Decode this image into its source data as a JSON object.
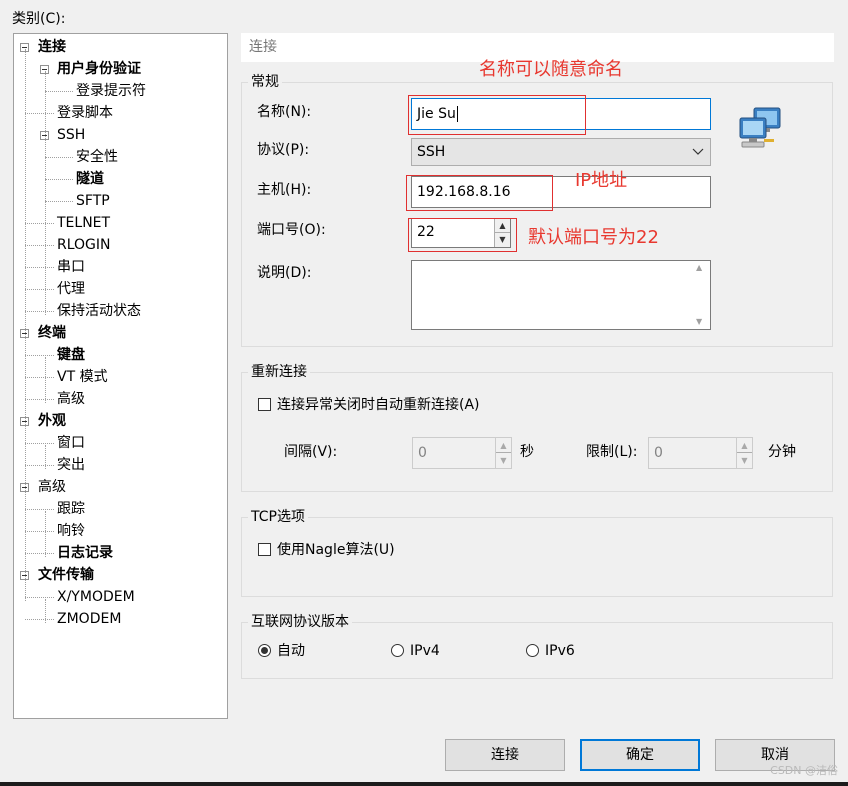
{
  "category_label": "类别(C):",
  "tree": [
    {
      "label": "连接",
      "bold": true,
      "level": 0,
      "toggle": true
    },
    {
      "label": "用户身份验证",
      "bold": true,
      "level": 1,
      "toggle": true
    },
    {
      "label": "登录提示符",
      "bold": false,
      "level": 2
    },
    {
      "label": "登录脚本",
      "bold": false,
      "level": 1
    },
    {
      "label": "SSH",
      "bold": false,
      "level": 1,
      "toggle": true
    },
    {
      "label": "安全性",
      "bold": false,
      "level": 2
    },
    {
      "label": "隧道",
      "bold": true,
      "level": 2
    },
    {
      "label": "SFTP",
      "bold": false,
      "level": 2
    },
    {
      "label": "TELNET",
      "bold": false,
      "level": 1
    },
    {
      "label": "RLOGIN",
      "bold": false,
      "level": 1
    },
    {
      "label": "串口",
      "bold": false,
      "level": 1
    },
    {
      "label": "代理",
      "bold": false,
      "level": 1
    },
    {
      "label": "保持活动状态",
      "bold": false,
      "level": 1
    },
    {
      "label": "终端",
      "bold": true,
      "level": 0,
      "toggle": true
    },
    {
      "label": "键盘",
      "bold": true,
      "level": 1
    },
    {
      "label": "VT 模式",
      "bold": false,
      "level": 1
    },
    {
      "label": "高级",
      "bold": false,
      "level": 1
    },
    {
      "label": "外观",
      "bold": true,
      "level": 0,
      "toggle": true
    },
    {
      "label": "窗口",
      "bold": false,
      "level": 1
    },
    {
      "label": "突出",
      "bold": false,
      "level": 1
    },
    {
      "label": "高级",
      "bold": false,
      "level": 0,
      "toggle": true
    },
    {
      "label": "跟踪",
      "bold": false,
      "level": 1
    },
    {
      "label": "响铃",
      "bold": false,
      "level": 1
    },
    {
      "label": "日志记录",
      "bold": true,
      "level": 1
    },
    {
      "label": "文件传输",
      "bold": true,
      "level": 0,
      "toggle": true
    },
    {
      "label": "X/YMODEM",
      "bold": false,
      "level": 1
    },
    {
      "label": "ZMODEM",
      "bold": false,
      "level": 1
    }
  ],
  "section_header": "连接",
  "general": {
    "title": "常规",
    "name_label": "名称(N):",
    "name_value": "Jie Su",
    "protocol_label": "协议(P):",
    "protocol_value": "SSH",
    "host_label": "主机(H):",
    "host_value": "192.168.8.16",
    "port_label": "端口号(O):",
    "port_value": "22",
    "desc_label": "说明(D):",
    "desc_value": ""
  },
  "reconnect": {
    "title": "重新连接",
    "checkbox_label": "连接异常关闭时自动重新连接(A)",
    "checked": false,
    "interval_label": "间隔(V):",
    "interval_value": "0",
    "interval_unit": "秒",
    "limit_label": "限制(L):",
    "limit_value": "0",
    "limit_unit": "分钟"
  },
  "tcp": {
    "title": "TCP选项",
    "nagle_label": "使用Nagle算法(U)",
    "checked": false
  },
  "ip_version": {
    "title": "互联网协议版本",
    "options": [
      "自动",
      "IPv4",
      "IPv6"
    ],
    "selected": "自动"
  },
  "buttons": {
    "connect": "连接",
    "ok": "确定",
    "cancel": "取消"
  },
  "annotations": {
    "name_note": "名称可以随意命名",
    "host_note": "IP地址",
    "port_note": "默认端口号为22"
  },
  "annotation_color": "#e8382f",
  "accent_color": "#0078d7",
  "watermark": "CSDN @洁俗",
  "icon": "network-computers-icon"
}
